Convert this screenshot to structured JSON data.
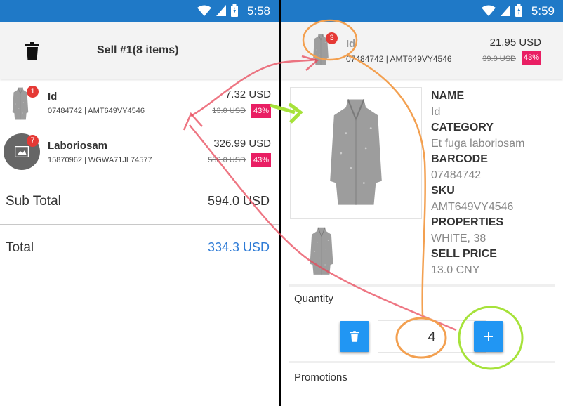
{
  "left": {
    "status_time": "5:58",
    "title": "Sell #1(8 items)",
    "items": [
      {
        "badge": "1",
        "name": "Id",
        "codes": "07484742 | AMT649VY4546",
        "price": "7.32 USD",
        "old_price": "13.0 USD",
        "discount": "43%"
      },
      {
        "badge": "7",
        "name": "Laboriosam",
        "codes": "15870962 | WGWA71JL74577",
        "price": "326.99 USD",
        "old_price": "586.0 USD",
        "discount": "43%"
      }
    ],
    "subtotal": {
      "label": "Sub Total",
      "value": "594.0 USD"
    },
    "total": {
      "label": "Total",
      "value": "334.3 USD",
      "color": "#2e7bd6"
    }
  },
  "right": {
    "status_time": "5:59",
    "header": {
      "badge": "3",
      "name": "Id",
      "codes": "07484742 | AMT649VY4546",
      "price": "21.95 USD",
      "old_price": "39.0 USD",
      "discount": "43%"
    },
    "details": [
      {
        "key": "NAME",
        "value": "Id"
      },
      {
        "key": "CATEGORY",
        "value": "Et fuga laboriosam"
      },
      {
        "key": "BARCODE",
        "value": "07484742"
      },
      {
        "key": "SKU",
        "value": "AMT649VY4546"
      },
      {
        "key": "PROPERTIES",
        "value": "WHITE, 38"
      },
      {
        "key": "SELL PRICE",
        "value": "13.0 CNY"
      }
    ],
    "quantity_label": "Quantity",
    "quantity_value": "4",
    "promotions_label": "Promotions"
  },
  "icons": {
    "status": [
      "wifi-icon",
      "signal-icon",
      "battery-icon"
    ],
    "delete": "trash-icon",
    "increment": "plus-icon",
    "image_placeholder": "image-placeholder-icon",
    "product": "coat-image"
  },
  "colors": {
    "status_bar": "#1f79c7",
    "accent_button": "#2196f3",
    "discount_badge": "#e91e63",
    "count_badge": "#e53935",
    "annotation_red": "#e8485a",
    "annotation_orange": "#f3a050",
    "annotation_green": "#a6e23a"
  }
}
